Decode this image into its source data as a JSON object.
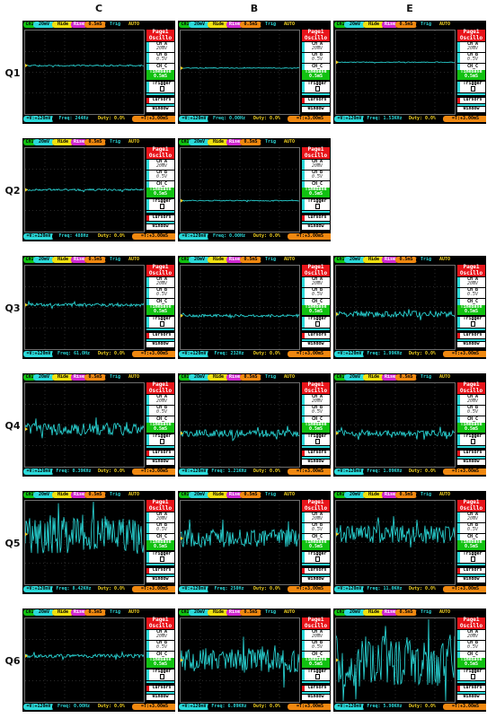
{
  "columns": [
    "C",
    "B",
    "E"
  ],
  "rows": [
    "Q1",
    "Q2",
    "Q3",
    "Q4",
    "Q5",
    "Q6"
  ],
  "colors": {
    "trace": "#2be0e0",
    "ch_pill": "#2bd9d9",
    "ch_active": "#11c211",
    "hide": "#f0e010",
    "rise": "#d028d0",
    "timebase_pill": "#f08810",
    "auto": "#f0d020",
    "page": "#e8141a"
  },
  "topbar": {
    "ch": "CH1",
    "volt": "20mV",
    "hide": "Hide",
    "rise": "Rise",
    "time": "0.5mS",
    "trig": "Trig",
    "auto": "AUTO"
  },
  "panel": {
    "page1": "Page1",
    "oscillo": "Oscillo",
    "cha": "CH_A",
    "cha_val": "20mV",
    "chb": "CH_B",
    "chb_val": "0.5V",
    "chc": "CH_C",
    "timebase": "TimeBase",
    "timebase_val": "0.5mS",
    "trigger": "Trigger",
    "cursors": "Cursors",
    "window": "Window"
  },
  "bottombar": {
    "vpp": "=V:+120mV",
    "duty": "Duty: 0.0%",
    "dt": "=T:+3.00mS"
  },
  "scopes": [
    {
      "row": "Q1",
      "col": "C",
      "freq": "Freq: 244Hz",
      "noise": 0.8,
      "base": 0.42
    },
    {
      "row": "Q1",
      "col": "B",
      "freq": "Freq: 0.00Hz",
      "noise": 0.4,
      "base": 0.45
    },
    {
      "row": "Q1",
      "col": "E",
      "freq": "Freq: 1.53KHz",
      "noise": 0.4,
      "base": 0.38
    },
    {
      "row": "Q2",
      "col": "C",
      "freq": "Freq: 488Hz",
      "noise": 1.0,
      "base": 0.5
    },
    {
      "row": "Q2",
      "col": "B",
      "freq": "Freq: 0.00Hz",
      "noise": 0.6,
      "base": 0.63
    },
    {
      "row": "Q3",
      "col": "C",
      "freq": "Freq: 61.0Hz",
      "noise": 1.8,
      "base": 0.47
    },
    {
      "row": "Q3",
      "col": "B",
      "freq": "Freq: 232Hz",
      "noise": 1.6,
      "base": 0.6
    },
    {
      "row": "Q3",
      "col": "E",
      "freq": "Freq: 1.99KHz",
      "noise": 3.5,
      "base": 0.58
    },
    {
      "row": "Q4",
      "col": "C",
      "freq": "Freq: 0.39KHz",
      "noise": 7.0,
      "base": 0.55
    },
    {
      "row": "Q4",
      "col": "B",
      "freq": "Freq: 1.21KHz",
      "noise": 4.0,
      "base": 0.6
    },
    {
      "row": "Q4",
      "col": "E",
      "freq": "Freq: 1.09KHz",
      "noise": 3.5,
      "base": 0.6
    },
    {
      "row": "Q5",
      "col": "C",
      "freq": "Freq: 8.42KHz",
      "noise": 22,
      "base": 0.4
    },
    {
      "row": "Q5",
      "col": "B",
      "freq": "Freq: 250Hz",
      "noise": 10,
      "base": 0.45
    },
    {
      "row": "Q5",
      "col": "E",
      "freq": "Freq: 11.0KHz",
      "noise": 10,
      "base": 0.4
    },
    {
      "row": "Q6",
      "col": "C",
      "freq": "Freq: 0.00Hz",
      "noise": 2.0,
      "base": 0.45
    },
    {
      "row": "Q6",
      "col": "B",
      "freq": "Freq: 6.09KHz",
      "noise": 14,
      "base": 0.5
    },
    {
      "row": "Q6",
      "col": "E",
      "freq": "Freq: 5.90KHz",
      "noise": 30,
      "base": 0.5
    }
  ]
}
